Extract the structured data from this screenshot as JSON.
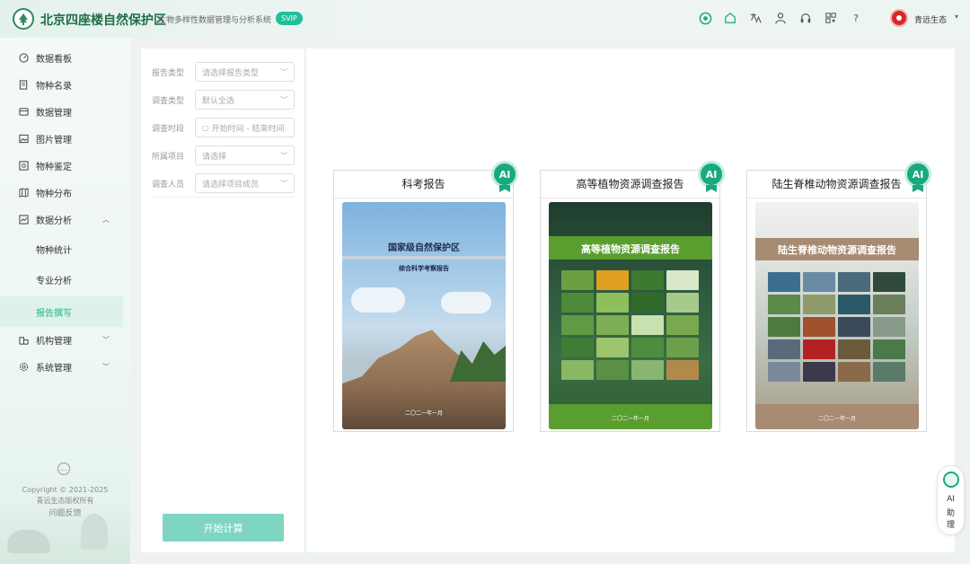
{
  "header": {
    "title": "北京四座楼自然保护区",
    "subtitle": "生物多样性数据管理与分析系统",
    "badge": "SVIP",
    "help": "?",
    "user_name": "青远生态",
    "icons": [
      "ai-assistant-icon",
      "home-icon",
      "translate-icon",
      "user-icon",
      "headset-icon",
      "qrcode-icon",
      "help-icon"
    ]
  },
  "sidebar": {
    "items": [
      {
        "label": "数据看板",
        "icon": "dashboard-icon"
      },
      {
        "label": "物种名录",
        "icon": "catalog-icon"
      },
      {
        "label": "数据管理",
        "icon": "database-icon"
      },
      {
        "label": "图片管理",
        "icon": "image-icon"
      },
      {
        "label": "物种鉴定",
        "icon": "identify-icon"
      },
      {
        "label": "物种分布",
        "icon": "map-icon"
      },
      {
        "label": "数据分析",
        "icon": "analysis-icon",
        "expanded": true
      },
      {
        "label": "物种统计"
      },
      {
        "label": "专业分析"
      },
      {
        "label": "报告撰写",
        "active": true
      },
      {
        "label": "机构管理",
        "icon": "org-icon"
      },
      {
        "label": "系统管理",
        "icon": "settings-icon"
      }
    ],
    "copyright_line1": "Copyright © 2021-2025",
    "copyright_line2": "青远生态版权所有",
    "feedback": "问题反馈"
  },
  "filters": {
    "report_type": {
      "label": "报告类型",
      "placeholder": "请选择报告类型"
    },
    "survey_type": {
      "label": "调查类型",
      "value": "默认全选"
    },
    "survey_time": {
      "label": "调查时段",
      "placeholder": "开始时间 - 结束时间"
    },
    "project": {
      "label": "所属项目",
      "placeholder": "请选择"
    },
    "members": {
      "label": "调查人员",
      "placeholder": "请选择项目成员"
    },
    "start_button": "开始计算"
  },
  "reports": [
    {
      "title": "科考报告",
      "badge": "AI",
      "cover_title": "国家级自然保护区",
      "cover_subtitle": "综合科学考察报告",
      "cover_date": "二〇二一年一月"
    },
    {
      "title": "高等植物资源调查报告",
      "badge": "AI",
      "cover_title": "高等植物资源调查报告",
      "cover_date": "二〇二一年一月"
    },
    {
      "title": "陆生脊椎动物资源调查报告",
      "badge": "AI",
      "cover_title": "陆生脊椎动物资源调查报告",
      "cover_date": "二〇二一年一月"
    }
  ],
  "ai_assistant": {
    "line1": "AI",
    "line2": "助",
    "line3": "理"
  },
  "colors": {
    "accent": "#1bb58b",
    "brand": "#1f6e4a",
    "button": "#7ed6c2"
  }
}
